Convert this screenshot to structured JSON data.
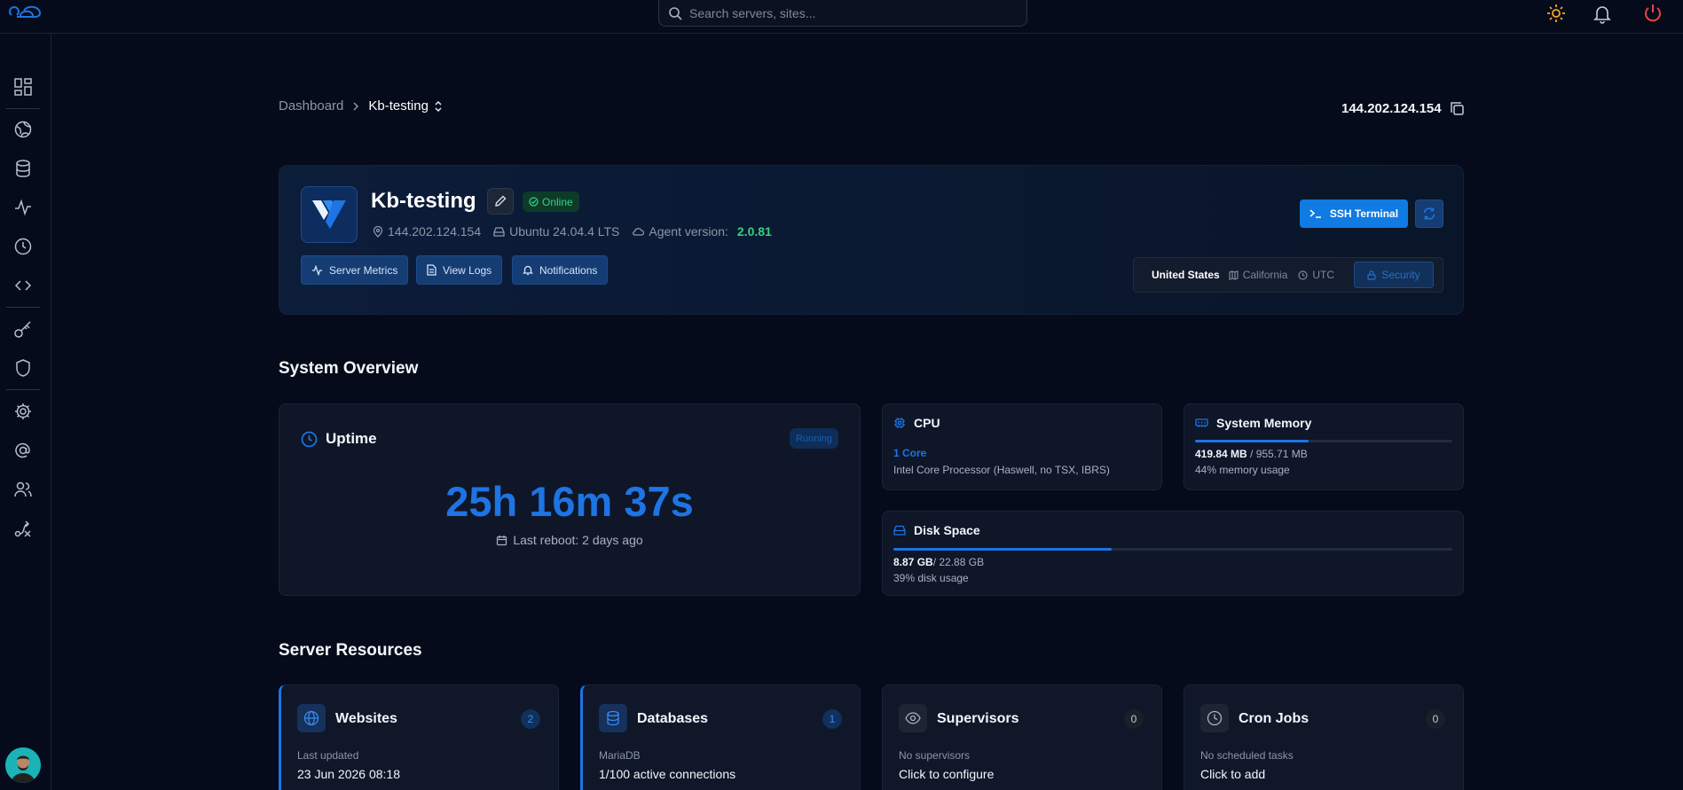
{
  "search": {
    "placeholder": "Search servers, sites..."
  },
  "breadcrumb": {
    "root": "Dashboard",
    "current": "Kb-testing"
  },
  "server_ip_header": "144.202.124.154",
  "server": {
    "name": "Kb-testing",
    "status": "Online",
    "ip": "144.202.124.154",
    "os": "Ubuntu 24.04.4 LTS",
    "agent_label": "Agent version:",
    "agent_version": "2.0.81",
    "buttons": {
      "metrics": "Server Metrics",
      "logs": "View Logs",
      "notifications": "Notifications"
    },
    "ssh_label": "SSH Terminal",
    "location": {
      "country": "United States",
      "region": "California",
      "timezone": "UTC",
      "security": "Security"
    }
  },
  "overview": {
    "title": "System Overview",
    "uptime": {
      "label": "Uptime",
      "badge": "Running",
      "value": "25h 16m 37s",
      "reboot": "Last reboot: 2 days ago"
    },
    "cpu": {
      "label": "CPU",
      "cores": "1 Core",
      "model": "Intel Core Processor (Haswell, no TSX, IBRS)"
    },
    "memory": {
      "label": "System Memory",
      "used": "419.84 MB",
      "total": " / 955.71 MB",
      "usage": "44% memory usage",
      "fraction": 0.44
    },
    "disk": {
      "label": "Disk Space",
      "used": "8.87 GB",
      "total": "/ 22.88 GB",
      "usage": "39% disk usage",
      "fraction": 0.39
    }
  },
  "resources": {
    "title": "Server Resources",
    "items": [
      {
        "title": "Websites",
        "count": "2",
        "sub": "Last updated",
        "main": "23 Jun 2026 08:18"
      },
      {
        "title": "Databases",
        "count": "1",
        "sub": "MariaDB",
        "main": "1/100 active connections"
      },
      {
        "title": "Supervisors",
        "count": "0",
        "sub": "No supervisors",
        "main": "Click to configure"
      },
      {
        "title": "Cron Jobs",
        "count": "0",
        "sub": "No scheduled tasks",
        "main": "Click to add"
      }
    ]
  },
  "colors": {
    "accent": "#1e74e3",
    "online": "#35d07f",
    "background": "#050b1a"
  },
  "icons": {
    "sidebar": [
      "dashboard-icon",
      "globe-icon",
      "database-icon",
      "activity-icon",
      "clock-icon",
      "code-icon",
      "key-icon",
      "shield-icon",
      "settings-icon",
      "at-sign-icon",
      "users-icon",
      "route-icon"
    ],
    "topbar": [
      "logo-icon",
      "search-icon",
      "sun-icon",
      "bell-icon",
      "power-icon"
    ]
  }
}
